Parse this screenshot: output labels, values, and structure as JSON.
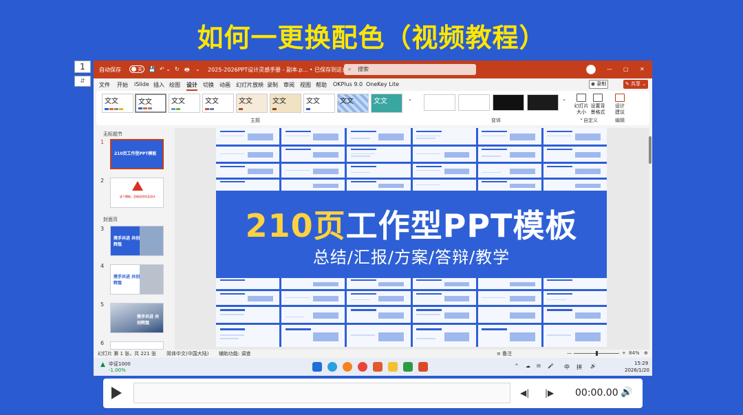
{
  "headline": "如何一更换配色（视频教程）",
  "page_box": {
    "number": "1",
    "sub": "⇵"
  },
  "titlebar": {
    "autosave_label": "自动保存",
    "autosave_state": "关",
    "filename": "2025-2026PPT设计灵感手册 - 副本.p...  •  已保存到这台电脑 ⌄",
    "search_placeholder": "搜索",
    "search_icon": "⌕",
    "controls": [
      "—",
      "▢",
      "✕"
    ],
    "qat_icons": [
      "💾",
      "↶ ⌄",
      "↻",
      "🖶",
      "⌄"
    ]
  },
  "tabs": [
    "文件",
    "开始",
    "iSlide",
    "插入",
    "绘图",
    "设计",
    "切换",
    "动画",
    "幻灯片放映",
    "录制",
    "审阅",
    "视图",
    "帮助",
    "OKPlus 9.0",
    "OneKey Lite"
  ],
  "active_tab": "设计",
  "record_label": "◉ 录制",
  "share_label": "✎ 共享 ⌄",
  "ribbon": {
    "theme_label": "文文",
    "group_theme": "主题",
    "group_variant": "变体",
    "group_custom": "自定义",
    "group_editor": "编辑",
    "btn_slide_size": [
      "幻灯片",
      "大小 ⌄"
    ],
    "btn_format_bg": [
      "设置背",
      "景格式"
    ],
    "btn_design_ideas": [
      "设计",
      "建议"
    ]
  },
  "thumbnails": {
    "section1": "无标题节",
    "section2": "封面页",
    "items": [
      {
        "num": "1",
        "text": "210页工作型PPT模板"
      },
      {
        "num": "2",
        "text": "这个模板，总结适合作品设计"
      },
      {
        "num": "3",
        "text": "携手共进 共创辉煌"
      },
      {
        "num": "4",
        "text": "携手共进 共创辉煌"
      },
      {
        "num": "5",
        "text": "携手共进 共创辉煌"
      },
      {
        "num": "6",
        "text": ""
      }
    ]
  },
  "slide": {
    "title_num": "210页",
    "title_rest": "工作型PPT模板",
    "subtitle": "总结/汇报/方案/答辩/教学"
  },
  "status": {
    "slide_info": "幻灯片 第 1 张，共 221 张",
    "language": "简体中文(中国大陆)",
    "accessibility": "辅助功能: 调查",
    "notes": "≡ 备注",
    "zoom": "84%",
    "fit_icon": "⊕",
    "minus": "—",
    "plus": "+"
  },
  "taskbar": {
    "stock_name": "中证1000",
    "stock_change": "-1.00%",
    "tray_icons": [
      "^",
      "☁",
      "✉",
      "🎤",
      "🔊"
    ],
    "ime1": "中",
    "ime2": "拼",
    "time": "15:29",
    "date": "2026/1/20"
  },
  "player": {
    "time": "00:00.00",
    "rewind_icon": "◀|",
    "forward_icon": "|▶",
    "volume_icon": "🔊"
  },
  "colors": {
    "background": "#2a5bd0",
    "headline": "#ffe600",
    "ppt_accent": "#c43e1c",
    "slide_bg": "#2e5fd6",
    "slide_highlight": "#ffd23f"
  }
}
